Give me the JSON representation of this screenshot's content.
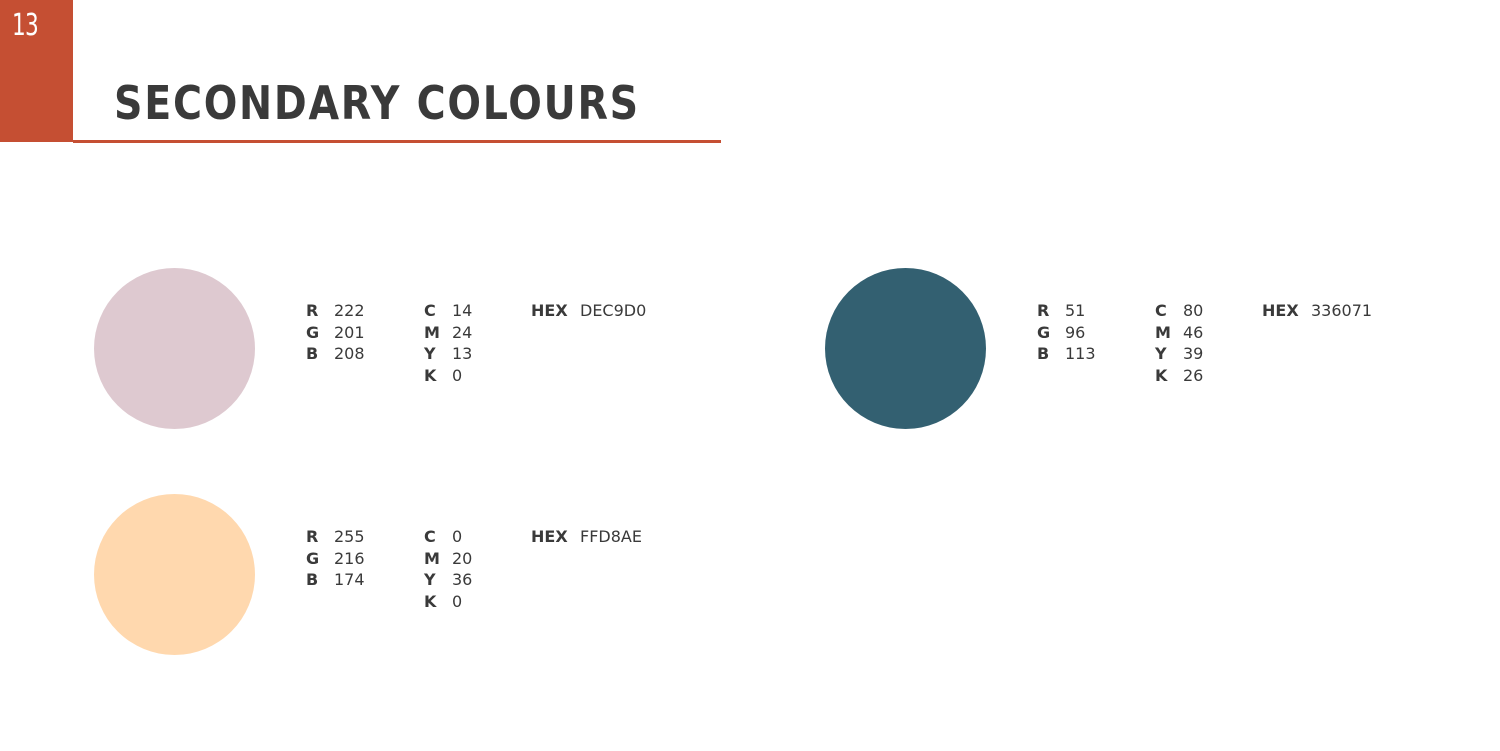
{
  "page": {
    "number": "13",
    "title": "SECONDARY COLOURS",
    "accent_color": "#C54F33"
  },
  "colours": [
    {
      "swatch_color": "#DEC9D0",
      "rgb": [
        {
          "label": "R",
          "value": "222"
        },
        {
          "label": "G",
          "value": "201"
        },
        {
          "label": "B",
          "value": "208"
        }
      ],
      "cmyk": [
        {
          "label": "C",
          "value": "14"
        },
        {
          "label": "M",
          "value": "24"
        },
        {
          "label": "Y",
          "value": "13"
        },
        {
          "label": "K",
          "value": "0"
        }
      ],
      "hex_label": "HEX",
      "hex_value": "DEC9D0"
    },
    {
      "swatch_color": "#336071",
      "rgb": [
        {
          "label": "R",
          "value": "51"
        },
        {
          "label": "G",
          "value": "96"
        },
        {
          "label": "B",
          "value": "113"
        }
      ],
      "cmyk": [
        {
          "label": "C",
          "value": "80"
        },
        {
          "label": "M",
          "value": "46"
        },
        {
          "label": "Y",
          "value": "39"
        },
        {
          "label": "K",
          "value": "26"
        }
      ],
      "hex_label": "HEX",
      "hex_value": "336071"
    },
    {
      "swatch_color": "#FFD8AE",
      "rgb": [
        {
          "label": "R",
          "value": "255"
        },
        {
          "label": "G",
          "value": "216"
        },
        {
          "label": "B",
          "value": "174"
        }
      ],
      "cmyk": [
        {
          "label": "C",
          "value": "0"
        },
        {
          "label": "M",
          "value": "20"
        },
        {
          "label": "Y",
          "value": "36"
        },
        {
          "label": "K",
          "value": "0"
        }
      ],
      "hex_label": "HEX",
      "hex_value": "FFD8AE"
    }
  ]
}
